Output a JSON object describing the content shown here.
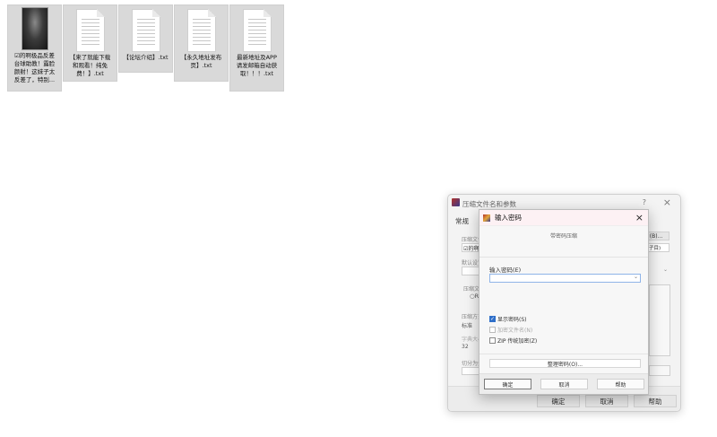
{
  "desktop": {
    "files": [
      {
        "name": "☑的啊极品反差台球助教！露脸颜射！这妹子太反差了，特别...",
        "kind": "image"
      },
      {
        "name": "【来了就能下载和观看！纯免费！】.txt",
        "kind": "text"
      },
      {
        "name": "【论坛介绍】.txt",
        "kind": "text"
      },
      {
        "name": "【永久地址发布页】.txt",
        "kind": "text"
      },
      {
        "name": "最新地址及APP请发邮箱自动获取！！！.txt",
        "kind": "text"
      }
    ]
  },
  "archive_dialog": {
    "title": "压缩文件名和参数",
    "help": "?",
    "close": "×",
    "tab_general": "常规",
    "label_archive_name": "压缩文件",
    "archive_name_value": "☑的啊",
    "browse_label": "(B)...",
    "label_default": "默认设置",
    "profile_value": "子目)",
    "label_archive_format": "压缩文件",
    "format_option": "R",
    "label_method": "压缩方式",
    "method_value": "标准",
    "label_dict": "字典大小",
    "dict_value": "32",
    "label_split": "切分为分卷",
    "ok": "确定",
    "cancel": "取消",
    "help_btn": "帮助"
  },
  "password_dialog": {
    "title": "输入密码",
    "subtitle": "带密码压缩",
    "password_label": "输入密码(E)",
    "password_value": "",
    "show_password": "显示密码(S)",
    "encrypt_filenames": "加密文件名(N)",
    "zip_legacy": "ZIP 传统加密(Z)",
    "organize": "整理密码(O)...",
    "ok": "确定",
    "cancel": "取消",
    "help": "帮助",
    "show_password_checked": true,
    "encrypt_filenames_checked": false,
    "zip_legacy_checked": false
  }
}
